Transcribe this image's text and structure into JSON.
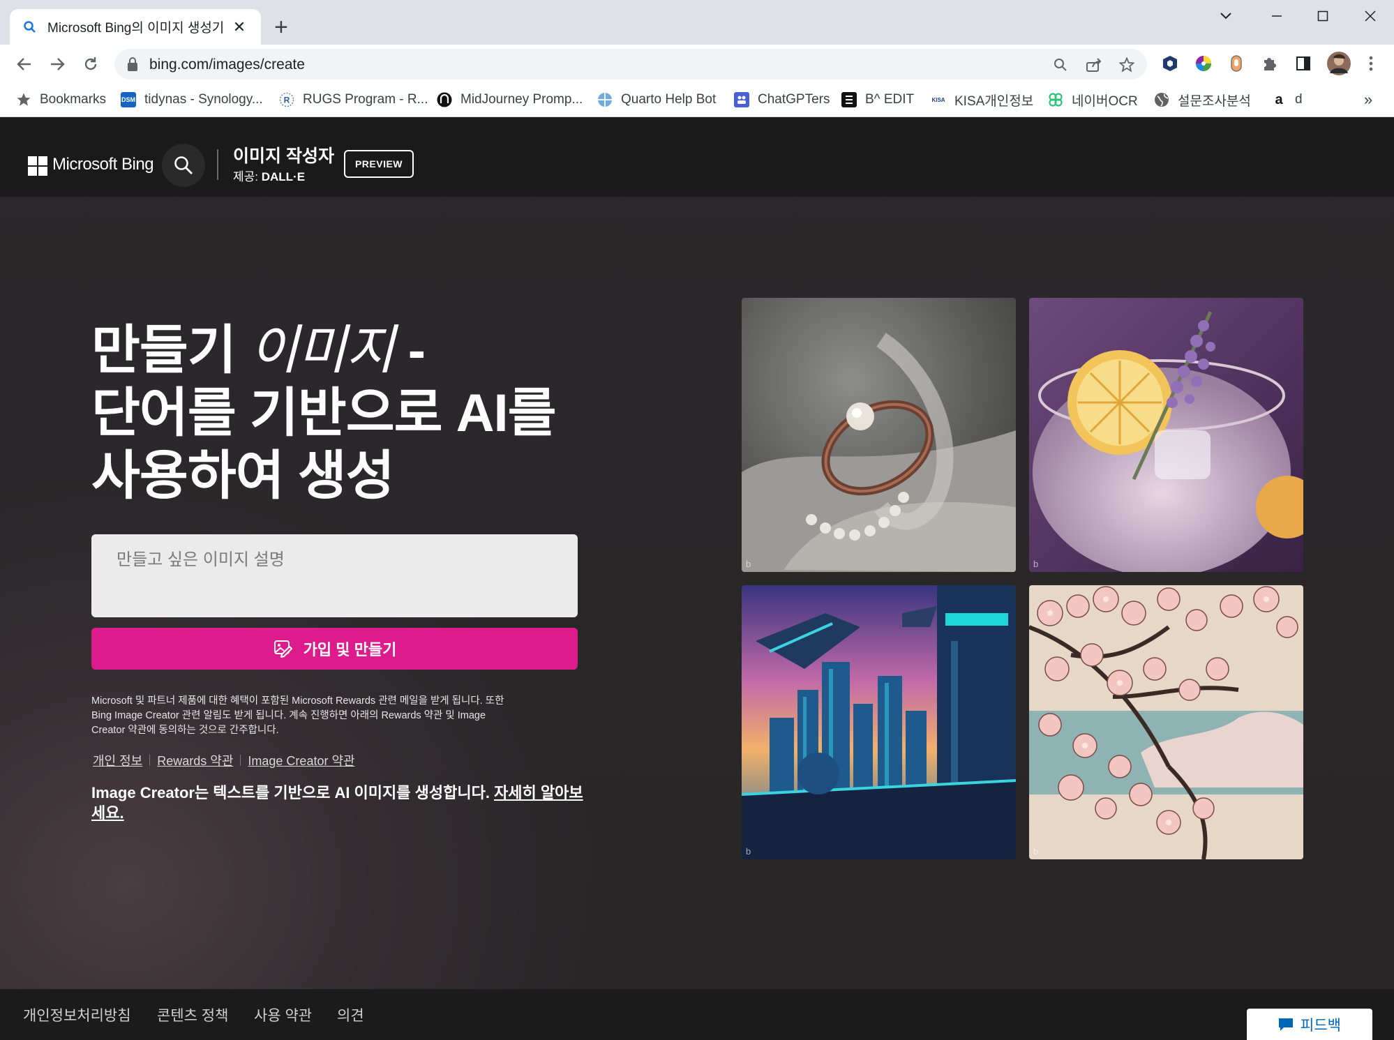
{
  "browser": {
    "tab_title": "Microsoft Bing의 이미지 생성기",
    "url": "bing.com/images/create",
    "bookmarks": [
      {
        "label": "Bookmarks",
        "icon": "star-icon"
      },
      {
        "label": "tidynas - Synology...",
        "icon": "dsm-icon"
      },
      {
        "label": "RUGS Program - R...",
        "icon": "r-icon"
      },
      {
        "label": "MidJourney Promp...",
        "icon": "midjourney-icon"
      },
      {
        "label": "Quarto Help Bot",
        "icon": "globe-icon"
      },
      {
        "label": "ChatGPTers",
        "icon": "chatgpters-icon"
      },
      {
        "label": "B^ EDIT",
        "icon": "edit-icon"
      },
      {
        "label": "KISA개인정보",
        "icon": "kisa-icon"
      },
      {
        "label": "네이버OCR",
        "icon": "clover-icon"
      },
      {
        "label": "설문조사분석",
        "icon": "globe-icon"
      },
      {
        "label": "d",
        "icon": "amazon-icon"
      }
    ],
    "favicon_letter": "Q",
    "dsm_badge": "DSM",
    "kisa_badge": "KISA",
    "amazon_badge": "a"
  },
  "header": {
    "brand": "Microsoft Bing",
    "product_title": "이미지 작성자",
    "subtitle_prefix": "제공: ",
    "subtitle_brand": "DALL·E",
    "preview_badge": "PREVIEW"
  },
  "hero": {
    "line1_prefix": "만들기 ",
    "line1_italic": "이미지",
    "line1_suffix": " -",
    "line2": "단어를 기반으로 AI를",
    "line3": "사용하여 생성"
  },
  "prompt": {
    "placeholder": "만들고 싶은 이미지 설명"
  },
  "cta": {
    "label": "가입 및 만들기"
  },
  "disclaimer": "Microsoft 및 파트너 제품에 대한 혜택이 포함된 Microsoft Rewards 관련 메일을 받게 됩니다. 또한 Bing Image Creator 관련 알림도 받게 됩니다. 계속 진행하면 아래의 Rewards 약관 및 Image Creator 약관에 동의하는 것으로 간주합니다.",
  "legal_links": [
    "개인 정보",
    "Rewards 약관",
    "Image Creator 약관"
  ],
  "about": {
    "text": "Image Creator는 텍스트를 기반으로 AI 이미지를 생성합니다. ",
    "link": "자세히 알아보세요."
  },
  "gallery": [
    {
      "name": "ring-image",
      "mark": "b"
    },
    {
      "name": "cocktail-image",
      "mark": "b"
    },
    {
      "name": "city-image",
      "mark": "b"
    },
    {
      "name": "blossom-image",
      "mark": "b"
    }
  ],
  "footer": {
    "links": [
      "개인정보처리방침",
      "콘텐츠 정책",
      "사용 약관",
      "의견"
    ],
    "feedback": "피드백"
  },
  "colors": {
    "accent": "#de1b8c",
    "header_bg": "#1a1a1a",
    "page_bg": "#2a2729"
  }
}
